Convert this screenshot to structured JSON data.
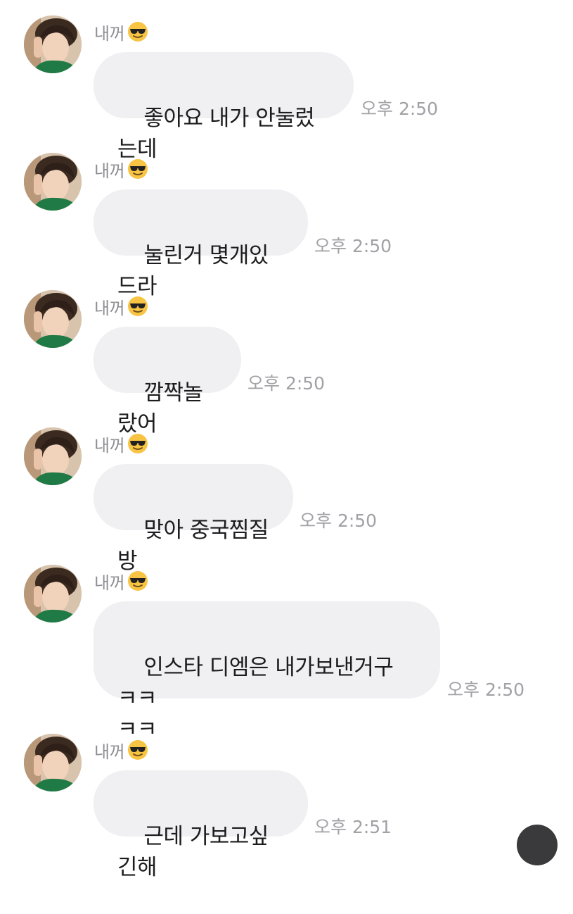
{
  "chat": {
    "messages": [
      {
        "sender": "내꺼",
        "sender_emoji": "smiling-face-with-sunglasses",
        "text": "좋아요 내가 안눌렀는데",
        "time": "오후 2:50"
      },
      {
        "sender": "내꺼",
        "sender_emoji": "smiling-face-with-sunglasses",
        "text": "눌린거 몇개있드라",
        "time": "오후 2:50"
      },
      {
        "sender": "내꺼",
        "sender_emoji": "smiling-face-with-sunglasses",
        "text": "깜짝놀랐어",
        "time": "오후 2:50"
      },
      {
        "sender": "내꺼",
        "sender_emoji": "smiling-face-with-sunglasses",
        "text": "맞아 중국찜질방",
        "time": "오후 2:50"
      },
      {
        "sender": "내꺼",
        "sender_emoji": "smiling-face-with-sunglasses",
        "text": "인스타 디엠은 내가보낸거구 ㅋㅋ\nㅋㅋ",
        "time": "오후 2:50"
      },
      {
        "sender": "내꺼",
        "sender_emoji": "smiling-face-with-sunglasses",
        "text": "근데 가보고싶긴해",
        "time": "오후 2:51"
      }
    ]
  },
  "colors": {
    "bubble_bg": "#f0f0f3",
    "sender_text": "#8e8e93",
    "time_text": "#a1a1a6",
    "message_text": "#1c1c1e"
  }
}
